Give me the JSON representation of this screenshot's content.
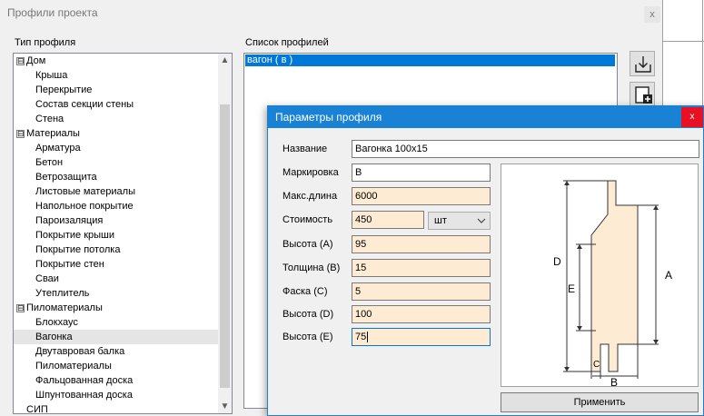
{
  "window": {
    "title": "Профили проекта",
    "close_glyph": "x"
  },
  "profile_type": {
    "label": "Тип профиля",
    "tree": [
      {
        "label": "Дом",
        "level": 0,
        "expander": "⊟"
      },
      {
        "label": "Крыша",
        "level": 1
      },
      {
        "label": "Перекрытие",
        "level": 1
      },
      {
        "label": "Состав секции стены",
        "level": 1
      },
      {
        "label": "Стена",
        "level": 1
      },
      {
        "label": "Материалы",
        "level": 0,
        "expander": "⊟"
      },
      {
        "label": "Арматура",
        "level": 1
      },
      {
        "label": "Бетон",
        "level": 1
      },
      {
        "label": "Ветрозащита",
        "level": 1
      },
      {
        "label": "Листовые материалы",
        "level": 1
      },
      {
        "label": "Напольное покрытие",
        "level": 1
      },
      {
        "label": "Пароизаляция",
        "level": 1
      },
      {
        "label": "Покрытие крыши",
        "level": 1
      },
      {
        "label": "Покрытие потолка",
        "level": 1
      },
      {
        "label": "Покрытие стен",
        "level": 1
      },
      {
        "label": "Сваи",
        "level": 1
      },
      {
        "label": "Утеплитель",
        "level": 1
      },
      {
        "label": "Пиломатериалы",
        "level": 0,
        "expander": "⊟"
      },
      {
        "label": "Блокхаус",
        "level": 1
      },
      {
        "label": "Вагонка",
        "level": 1,
        "selected": true
      },
      {
        "label": "Двутавровая балка",
        "level": 1
      },
      {
        "label": "Пиломатериалы",
        "level": 1
      },
      {
        "label": "Фальцованная доска",
        "level": 1
      },
      {
        "label": "Шпунтованная доска",
        "level": 1
      },
      {
        "label": "СИП",
        "level": 0
      }
    ],
    "scroll_up_glyph": "▲",
    "scroll_down_glyph": "▼"
  },
  "profile_list": {
    "label": "Список профилей",
    "items": [
      {
        "label": "вагон ( в )",
        "selected": true
      }
    ],
    "icons": [
      "import-icon",
      "add-icon"
    ]
  },
  "dialog": {
    "title": "Параметры профиля",
    "close_glyph": "x",
    "fields": [
      {
        "label": "Название",
        "value": "Вагонка 100x15"
      },
      {
        "label": "Маркировка",
        "value": "В"
      },
      {
        "label": "Макс.длина",
        "value": "6000"
      },
      {
        "label": "Стоимость",
        "value": "450"
      },
      {
        "label": "Высота (А)",
        "value": "95"
      },
      {
        "label": "Толщина (В)",
        "value": "15"
      },
      {
        "label": "Фаска (С)",
        "value": "5"
      },
      {
        "label": "Высота (D)",
        "value": "100"
      },
      {
        "label": "Высота (Е)",
        "value": "75"
      }
    ],
    "unit": {
      "selected": "шт"
    },
    "diagram_labels": {
      "d": "D",
      "e": "E",
      "a": "A",
      "c": "C",
      "b": "B"
    },
    "apply_label": "Применить"
  },
  "colors": {
    "title_bar": "#1a82d4",
    "selection": "#0078d7",
    "input_tan": "#fdebd3",
    "profile_fill": "#fdebd3",
    "close_red": "#e81123"
  }
}
